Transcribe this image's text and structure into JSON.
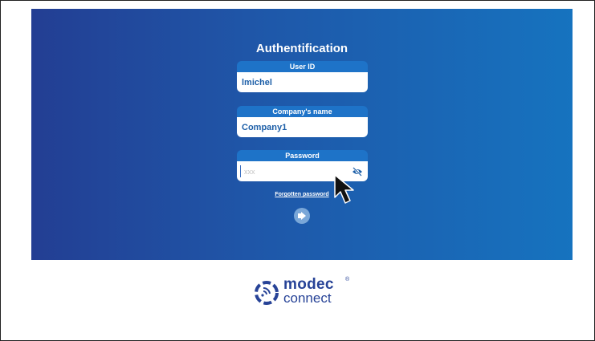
{
  "auth": {
    "title": "Authentification",
    "user_id": {
      "label": "User ID",
      "value": "lmichel"
    },
    "company": {
      "label": "Company's name",
      "value": "Company1"
    },
    "password": {
      "label": "Password",
      "placeholder": "xxx"
    },
    "forgot_label": "Forgotten password",
    "login_icon": "login-arrow-icon",
    "visibility_icon": "eye-slash-icon"
  },
  "brand": {
    "name_line1": "modec",
    "name_line2": "connect",
    "registered_mark": "®"
  },
  "colors": {
    "panel_gradient_start": "#233e93",
    "panel_gradient_end": "#1673bf",
    "field_header": "#1e73c8",
    "brand": "#274397"
  }
}
